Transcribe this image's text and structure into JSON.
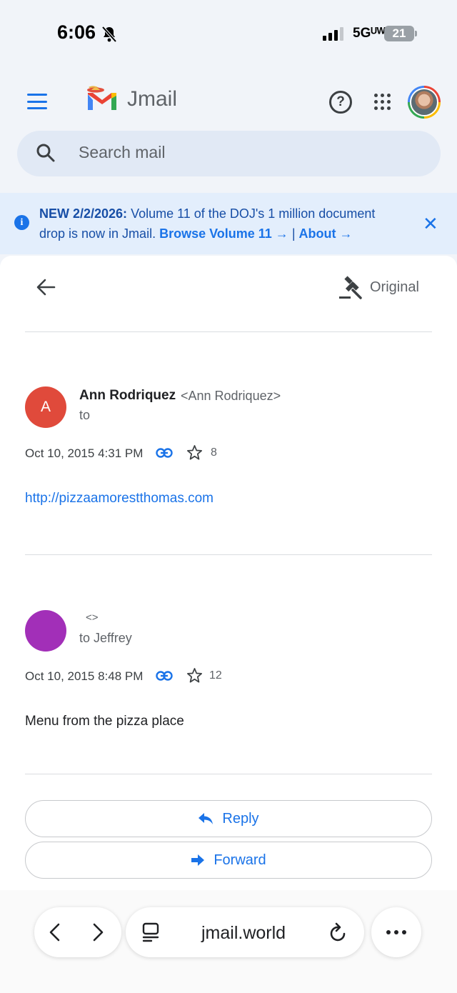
{
  "status_bar": {
    "time": "6:06",
    "network": "5Gᵁᵂ",
    "battery": "21"
  },
  "app_bar": {
    "brand": "Jmail",
    "help_symbol": "?"
  },
  "search": {
    "placeholder": "Search mail"
  },
  "banner": {
    "bold_prefix": "NEW 2/2/2026:",
    "message": " Volume 11 of the DOJ's 1 million document drop is now in Jmail. ",
    "browse_link": "Browse Volume 11 →",
    "separator": " | ",
    "about_link": "About →",
    "close_symbol": "✕",
    "info_symbol": "i"
  },
  "toolbar": {
    "original_label": "Original"
  },
  "messages": [
    {
      "avatar_letter": "A",
      "avatar_color": "#e04a3b",
      "sender_name": "Ann Rodriquez",
      "sender_email": "<Ann Rodriquez>",
      "to": "to",
      "date": "Oct 10, 2015 4:31 PM",
      "star_count": "8",
      "body_link": "http://pizzaamorestthomas.com"
    },
    {
      "avatar_letter": "",
      "avatar_color": "#a22fb8",
      "sender_name": "",
      "sender_email": "<>",
      "to": "to Jeffrey",
      "date": "Oct 10, 2015 8:48 PM",
      "star_count": "12",
      "body_text": "Menu from the pizza place"
    }
  ],
  "actions": {
    "reply_label": "Reply",
    "forward_label": "Forward"
  },
  "browser": {
    "url": "jmail.world"
  },
  "colors": {
    "accent": "#1a73e8",
    "banner_bg": "#e3eefc",
    "search_bg": "#e1e9f5"
  }
}
